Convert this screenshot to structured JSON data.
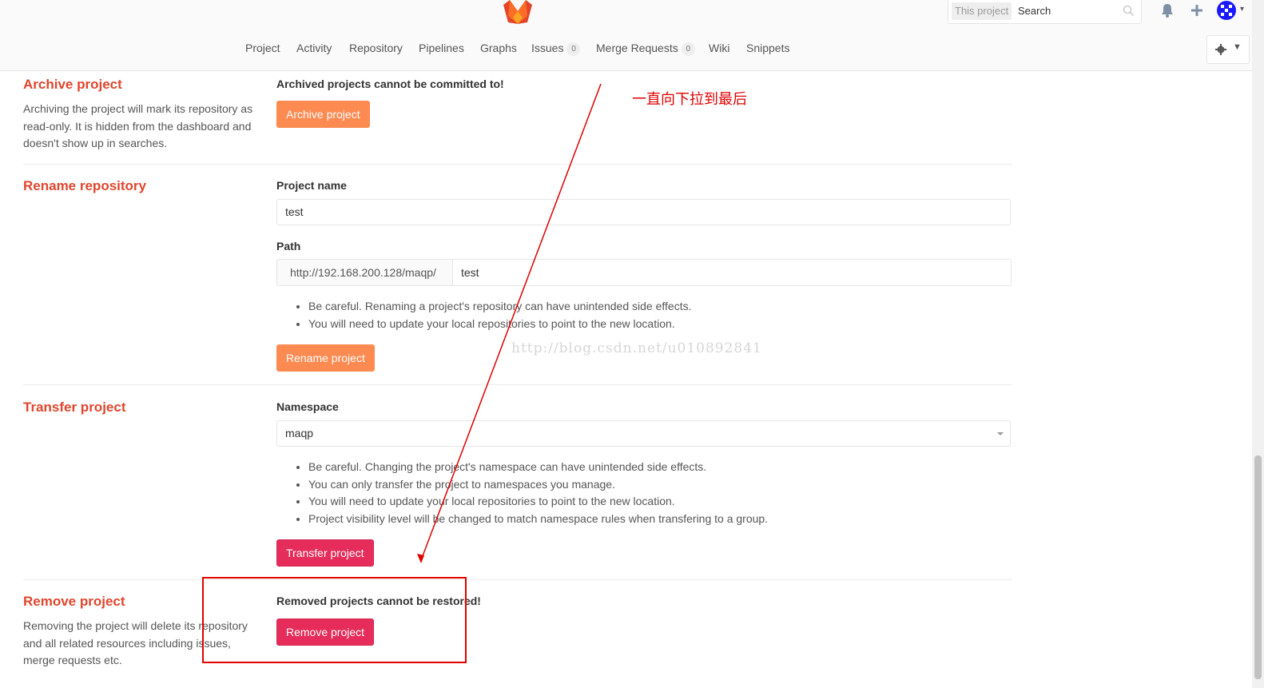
{
  "header": {
    "search": {
      "scope": "This project",
      "placeholder": "Search"
    },
    "nav": [
      {
        "label": "Project"
      },
      {
        "label": "Activity"
      },
      {
        "label": "Repository"
      },
      {
        "label": "Pipelines"
      },
      {
        "label": "Graphs"
      },
      {
        "label": "Issues",
        "count": "0"
      },
      {
        "label": "Merge Requests",
        "count": "0"
      },
      {
        "label": "Wiki"
      },
      {
        "label": "Snippets"
      }
    ]
  },
  "archive": {
    "title": "Archive project",
    "description": "Archiving the project will mark its repository as read-only. It is hidden from the dashboard and doesn't show up in searches.",
    "warning": "Archived projects cannot be committed to!",
    "button": "Archive project"
  },
  "rename": {
    "title": "Rename repository",
    "name_label": "Project name",
    "name_value": "test",
    "path_label": "Path",
    "path_prefix": "http://192.168.200.128/maqp/",
    "path_value": "test",
    "notes": [
      "Be careful. Renaming a project's repository can have unintended side effects.",
      "You will need to update your local repositories to point to the new location."
    ],
    "button": "Rename project"
  },
  "transfer": {
    "title": "Transfer project",
    "namespace_label": "Namespace",
    "namespace_value": "maqp",
    "notes": [
      "Be careful. Changing the project's namespace can have unintended side effects.",
      "You can only transfer the project to namespaces you manage.",
      "You will need to update your local repositories to point to the new location.",
      "Project visibility level will be changed to match namespace rules when transfering to a group."
    ],
    "button": "Transfer project"
  },
  "remove": {
    "title": "Remove project",
    "description": "Removing the project will delete its repository and all related resources including issues, merge requests etc.",
    "warning": "Removed projects cannot be restored!",
    "button": "Remove project"
  },
  "annotation": {
    "text": "一直向下拉到最后",
    "color": "#e00000"
  },
  "watermark": "http://blog.csdn.net/u010892841",
  "colors": {
    "title_red": "#e0462e",
    "btn_orange": "#fc8a51",
    "btn_danger": "#e52c5a"
  }
}
